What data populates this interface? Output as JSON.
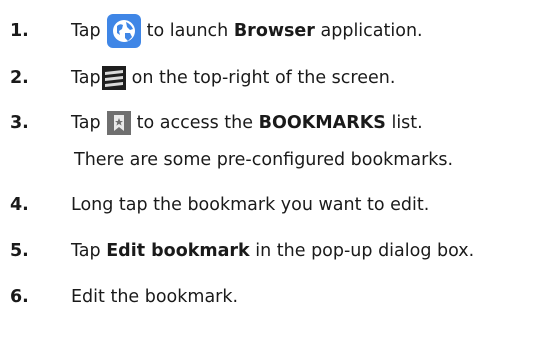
{
  "icons": {
    "browser": "globe-icon",
    "menu": "menu-icon",
    "bookmarks": "bookmark-star-icon"
  },
  "colors": {
    "browser_icon_blue": "#3f86e6",
    "menu_icon_dark": "#1e1e1e",
    "bookmark_icon_gray": "#6f6f6f"
  },
  "steps": [
    {
      "number": "1.",
      "before": "Tap",
      "after_icon": "to launch",
      "bold": "Browser",
      "after_bold": "application."
    },
    {
      "number": "2.",
      "before": "Tap",
      "after_icon": "on the top-right of the screen."
    },
    {
      "number": "3.",
      "before": "Tap",
      "after_icon": "to access the",
      "bold": "BOOKMARKS",
      "after_bold": "list.",
      "note": "There are some pre-configured bookmarks."
    },
    {
      "number": "4.",
      "text": "Long tap the bookmark you want to edit."
    },
    {
      "number": "5.",
      "before": "Tap",
      "bold": "Edit bookmark",
      "after_bold": "in the pop-up dialog box."
    },
    {
      "number": "6.",
      "text": "Edit the bookmark."
    }
  ]
}
